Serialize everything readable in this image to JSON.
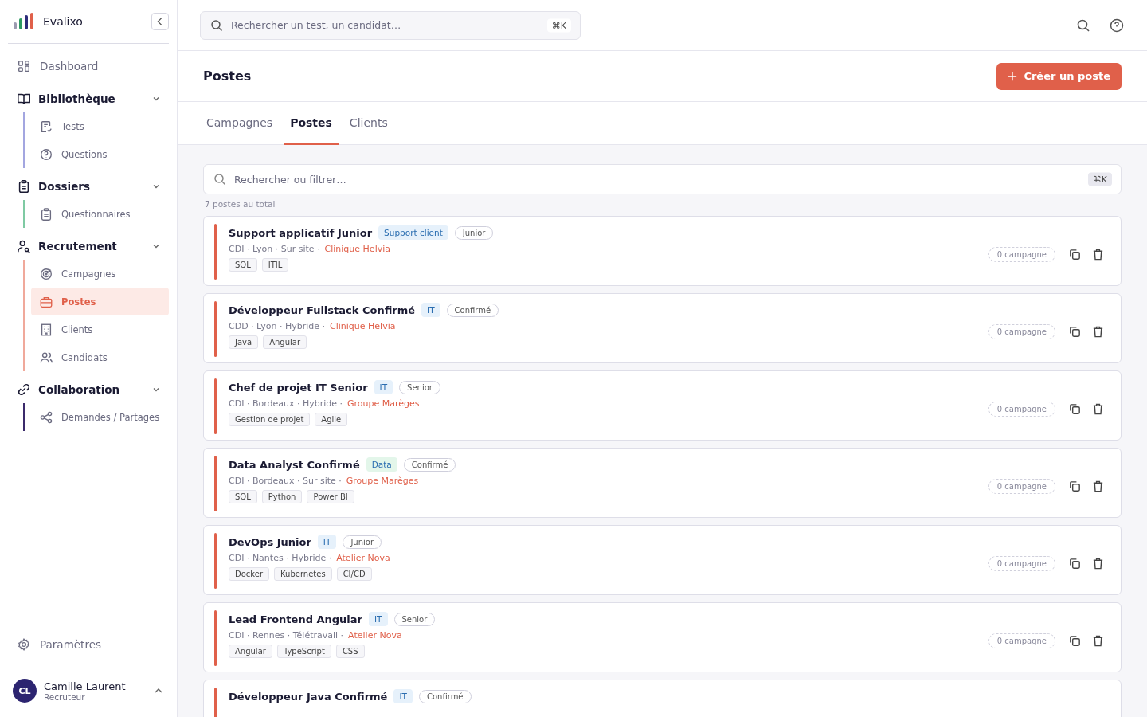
{
  "brand": {
    "name": "Evalixo"
  },
  "sidebar": {
    "dashboard": {
      "label": "Dashboard"
    },
    "groups": [
      {
        "label": "Bibliothèque",
        "expanded": true,
        "color": "#a3a6e0",
        "items": [
          {
            "label": "Tests",
            "selected": false
          },
          {
            "label": "Questions",
            "selected": false
          }
        ]
      },
      {
        "label": "Dossiers",
        "expanded": true,
        "color": "#7fcaa3",
        "items": [
          {
            "label": "Questionnaires",
            "selected": false
          }
        ]
      },
      {
        "label": "Recrutement",
        "expanded": true,
        "color": "#f0a99b",
        "items": [
          {
            "label": "Campagnes",
            "selected": false
          },
          {
            "label": "Postes",
            "selected": true
          },
          {
            "label": "Clients",
            "selected": false
          },
          {
            "label": "Candidats",
            "selected": false
          }
        ]
      },
      {
        "label": "Collaboration",
        "expanded": true,
        "color": "#3b2a6b",
        "items": [
          {
            "label": "Demandes / Partages",
            "selected": false
          }
        ]
      }
    ],
    "settings": {
      "label": "Paramètres"
    },
    "user": {
      "initials": "CL",
      "name": "Camille Laurent",
      "role": "Recruteur"
    }
  },
  "topbar": {
    "search": {
      "placeholder": "Rechercher un test, un candidat…",
      "shortcut": "⌘K"
    }
  },
  "page": {
    "title": "Postes",
    "create_button": "Créer un poste"
  },
  "tabs": [
    {
      "label": "Campagnes",
      "selected": false
    },
    {
      "label": "Postes",
      "selected": true
    },
    {
      "label": "Clients",
      "selected": false
    }
  ],
  "filter": {
    "placeholder": "Rechercher ou filtrer…",
    "shortcut": "⌘K",
    "total": "7 postes au total"
  },
  "postes": [
    {
      "title": "Support applicatif Junior",
      "category": {
        "label": "Support client",
        "color": "#e6f1fb"
      },
      "level": "Junior",
      "meta": "CDI · Lyon · Sur site ·",
      "client": "Clinique Helvia",
      "skills": [
        "SQL",
        "ITIL"
      ],
      "campaigns": "0 campagne"
    },
    {
      "title": "Développeur Fullstack Confirmé",
      "category": {
        "label": "IT",
        "color": "#e6f1fb"
      },
      "level": "Confirmé",
      "meta": "CDD · Lyon · Hybride ·",
      "client": "Clinique Helvia",
      "skills": [
        "Java",
        "Angular"
      ],
      "campaigns": "0 campagne"
    },
    {
      "title": "Chef de projet IT Senior",
      "category": {
        "label": "IT",
        "color": "#e6f1fb"
      },
      "level": "Senior",
      "meta": "CDI · Bordeaux · Hybride ·",
      "client": "Groupe Marèges",
      "skills": [
        "Gestion de projet",
        "Agile"
      ],
      "campaigns": "0 campagne"
    },
    {
      "title": "Data Analyst Confirmé",
      "category": {
        "label": "Data",
        "color": "#e3f6ea"
      },
      "level": "Confirmé",
      "meta": "CDI · Bordeaux · Sur site ·",
      "client": "Groupe Marèges",
      "skills": [
        "SQL",
        "Python",
        "Power BI"
      ],
      "campaigns": "0 campagne"
    },
    {
      "title": "DevOps Junior",
      "category": {
        "label": "IT",
        "color": "#e6f1fb"
      },
      "level": "Junior",
      "meta": "CDI · Nantes · Hybride ·",
      "client": "Atelier Nova",
      "skills": [
        "Docker",
        "Kubernetes",
        "CI/CD"
      ],
      "campaigns": "0 campagne"
    },
    {
      "title": "Lead Frontend Angular",
      "category": {
        "label": "IT",
        "color": "#e6f1fb"
      },
      "level": "Senior",
      "meta": "CDI · Rennes · Télétravail ·",
      "client": "Atelier Nova",
      "skills": [
        "Angular",
        "TypeScript",
        "CSS"
      ],
      "campaigns": "0 campagne"
    },
    {
      "title": "Développeur Java Confirmé",
      "category": {
        "label": "IT",
        "color": "#e6f1fb"
      },
      "level": "Confirmé"
    }
  ]
}
